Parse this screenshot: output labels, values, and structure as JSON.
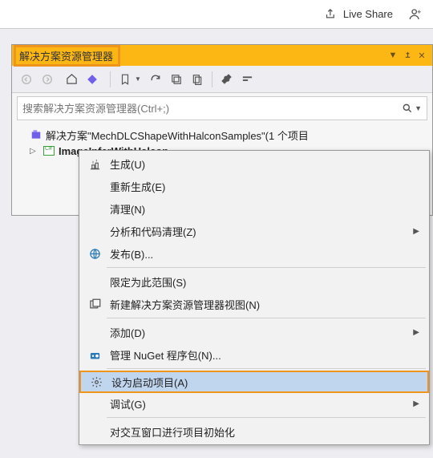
{
  "topbar": {
    "live_share": "Live Share"
  },
  "panel": {
    "title": "解决方案资源管理器"
  },
  "search": {
    "placeholder": "搜索解决方案资源管理器(Ctrl+;)"
  },
  "tree": {
    "solution": "解决方案\"MechDLCShapeWithHalconSamples\"(1 个项目",
    "project": "ImageInferWithHalcon"
  },
  "menu": {
    "items": [
      {
        "label": "生成(U)",
        "icon": "build",
        "sep_after": false
      },
      {
        "label": "重新生成(E)",
        "icon": "",
        "sep_after": false
      },
      {
        "label": "清理(N)",
        "icon": "",
        "sep_after": false
      },
      {
        "label": "分析和代码清理(Z)",
        "icon": "",
        "arrow": true,
        "sep_after": false
      },
      {
        "label": "发布(B)...",
        "icon": "publish",
        "sep_after": true
      },
      {
        "label": "限定为此范围(S)",
        "icon": "",
        "sep_after": false
      },
      {
        "label": "新建解决方案资源管理器视图(N)",
        "icon": "newview",
        "sep_after": true
      },
      {
        "label": "添加(D)",
        "icon": "",
        "arrow": true,
        "sep_after": false
      },
      {
        "label": "管理 NuGet 程序包(N)...",
        "icon": "nuget",
        "sep_after": true
      },
      {
        "label": "设为启动项目(A)",
        "icon": "gear",
        "highlighted": true,
        "sep_after": false
      },
      {
        "label": "调试(G)",
        "icon": "",
        "arrow": true,
        "sep_after": true
      },
      {
        "label": "对交互窗口进行项目初始化",
        "icon": "",
        "sep_after": false
      }
    ]
  }
}
